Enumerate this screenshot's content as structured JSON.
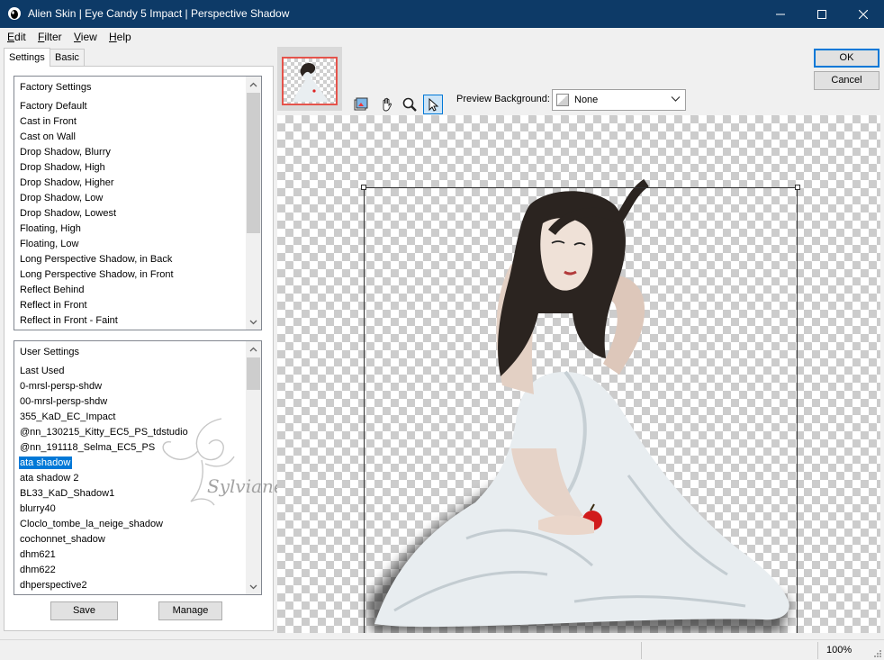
{
  "window": {
    "title": "Alien Skin | Eye Candy 5 Impact | Perspective Shadow"
  },
  "menu": [
    {
      "label": "Edit",
      "accel": "E",
      "rest": "dit"
    },
    {
      "label": "Filter",
      "accel": "F",
      "rest": "ilter"
    },
    {
      "label": "View",
      "accel": "V",
      "rest": "iew"
    },
    {
      "label": "Help",
      "accel": "H",
      "rest": "elp"
    }
  ],
  "tabs": [
    {
      "label": "Settings"
    },
    {
      "label": "Basic"
    }
  ],
  "factory": {
    "header": "Factory Settings",
    "items": [
      "Factory Default",
      "Cast in Front",
      "Cast on Wall",
      "Drop Shadow, Blurry",
      "Drop Shadow, High",
      "Drop Shadow, Higher",
      "Drop Shadow, Low",
      "Drop Shadow, Lowest",
      "Floating, High",
      "Floating, Low",
      "Long Perspective Shadow, in Back",
      "Long Perspective Shadow, in Front",
      "Reflect Behind",
      "Reflect in Front",
      "Reflect in Front - Faint"
    ]
  },
  "user": {
    "header": "User Settings",
    "selected_index": 6,
    "items": [
      "Last Used",
      "0-mrsl-persp-shdw",
      "00-mrsl-persp-shdw",
      "355_KaD_EC_Impact",
      "@nn_130215_Kitty_EC5_PS_tdstudio",
      "@nn_191118_Selma_EC5_PS",
      "ata shadow",
      "ata shadow 2",
      "BL33_KaD_Shadow1",
      "blurry40",
      "Cloclo_tombe_la_neige_shadow",
      "cochonnet_shadow",
      "dhm621",
      "dhm622",
      "dhperspective2"
    ]
  },
  "buttons": {
    "save": "Save",
    "manage": "Manage",
    "ok": "OK",
    "cancel": "Cancel"
  },
  "preview": {
    "label": "Preview Background:",
    "value": "None"
  },
  "tools": [
    "toggle-preview-icon",
    "hand-icon",
    "zoom-icon",
    "pointer-icon"
  ],
  "watermark_text": "Sylviane",
  "status": {
    "zoom": "100%"
  },
  "colors": {
    "titlebar": "#0d3a67",
    "selection": "#0078d7",
    "thumb_border": "#e5534b"
  }
}
